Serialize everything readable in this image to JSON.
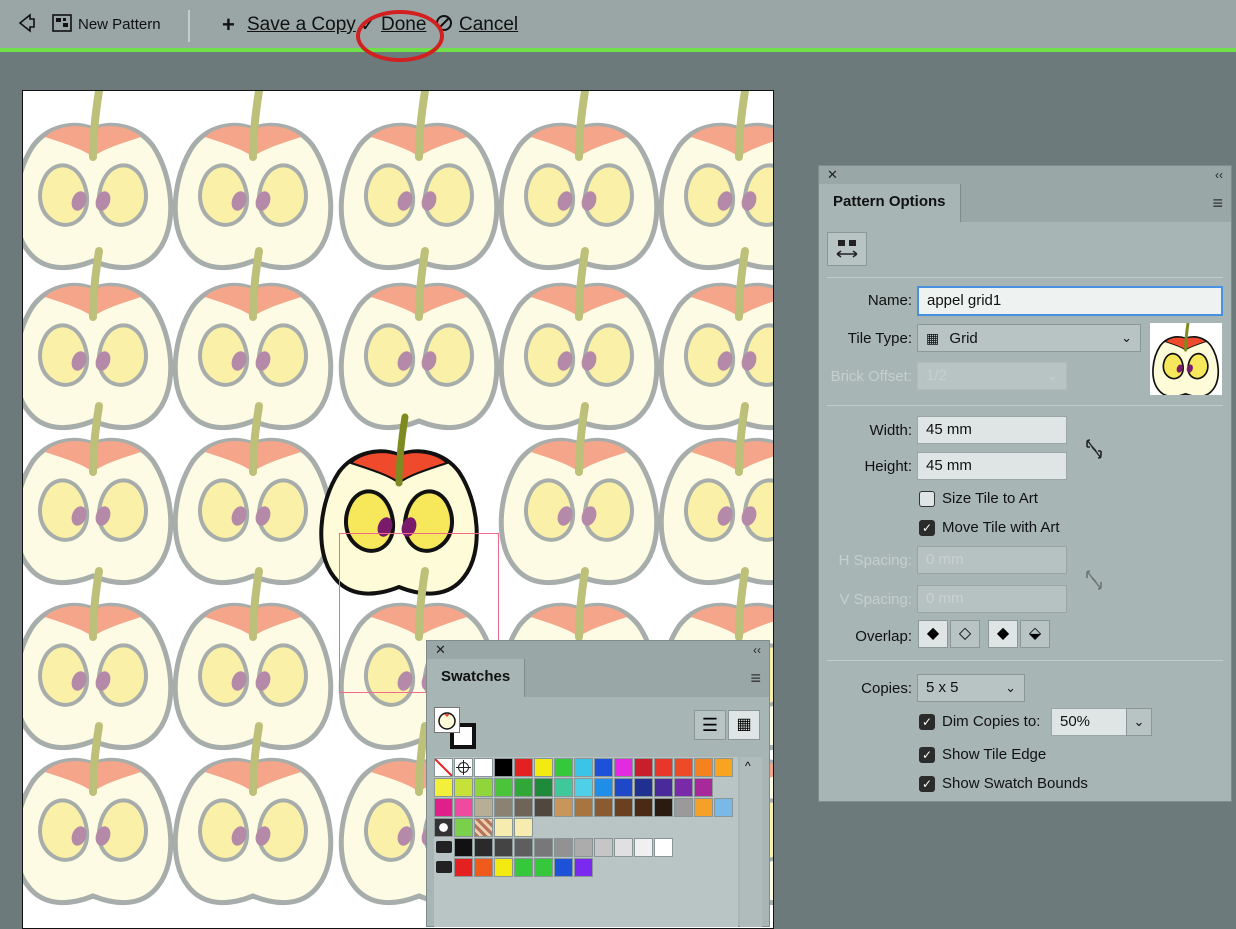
{
  "topbar": {
    "back_icon": "back-arrow-icon",
    "pattern_icon": "pattern-icon",
    "new_pattern": "New Pattern",
    "save_copy": "Save a Copy",
    "done": "Done",
    "cancel": "Cancel",
    "accent": "#6fe04a",
    "highlight": "#d21f1f"
  },
  "pattern_options": {
    "title": "Pattern Options",
    "name_label": "Name:",
    "name_value": "appel grid1",
    "tile_type_label": "Tile Type:",
    "tile_type_value": "Grid",
    "brick_offset_label": "Brick Offset:",
    "brick_offset_value": "1/2",
    "width_label": "Width:",
    "width_value": "45 mm",
    "height_label": "Height:",
    "height_value": "45 mm",
    "size_tile_to_art": "Size Tile to Art",
    "size_tile_to_art_checked": false,
    "move_tile_with_art": "Move Tile with Art",
    "move_tile_with_art_checked": true,
    "h_spacing_label": "H Spacing:",
    "h_spacing_value": "0 mm",
    "v_spacing_label": "V Spacing:",
    "v_spacing_value": "0 mm",
    "overlap_label": "Overlap:",
    "copies_label": "Copies:",
    "copies_value": "5 x 5",
    "dim_copies": "Dim Copies to:",
    "dim_copies_checked": true,
    "dim_value": "50%",
    "show_tile_edge": "Show Tile Edge",
    "show_tile_edge_checked": true,
    "show_swatch_bounds": "Show Swatch Bounds",
    "show_swatch_bounds_checked": true
  },
  "swatches": {
    "title": "Swatches",
    "rows": [
      [
        "#ffffff",
        "#ffffff",
        "#ffffff",
        "#000000",
        "#e52020",
        "#f2ea10",
        "#35c83a",
        "#39c4e8",
        "#1b52d8",
        "#e22ae0",
        "#c81f2a",
        "#e8362b",
        "#ee4a28",
        "#f5811f",
        "#f7a420"
      ],
      [
        "#f2f03a",
        "#c6e23a",
        "#8fd63a",
        "#4cc43a",
        "#2fa838",
        "#1e8a3a",
        "#3fc89a",
        "#4fd0e8",
        "#1e8ee8",
        "#1e48c8",
        "#203090",
        "#4a2a9a",
        "#7a2aa8",
        "#a82a9a"
      ],
      [
        "#e0208a",
        "#f04aa0",
        "#b8ae98",
        "#8c8274",
        "#6e6458",
        "#50483e",
        "#c8965a",
        "#a87440",
        "#8a5a30",
        "#6a4020",
        "#4a2a14",
        "#2a1a10",
        "#9a9a9a",
        "#f5a028",
        "#7ab8e8"
      ],
      [
        "#ffffff",
        "#7ad04a",
        "#b8745a",
        "#f6ecb0",
        "#f6ecb0"
      ],
      [
        "#111111",
        "#2a2a2a",
        "#444444",
        "#5e5e5e",
        "#787878",
        "#929292",
        "#acacac",
        "#c6c6c6",
        "#e0e0e0",
        "#f0f0f0",
        "#ffffff"
      ],
      [
        "#e52020",
        "#f05a1a",
        "#f2ea10",
        "#35c83a",
        "#35c83a",
        "#1b52d8",
        "#7a2aee"
      ]
    ]
  }
}
